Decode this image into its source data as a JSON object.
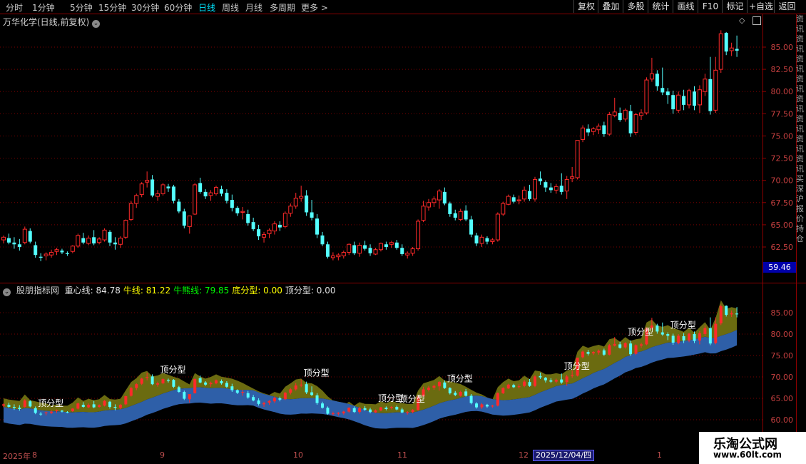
{
  "toolbar": {
    "periods": [
      "分时",
      "1分钟",
      "5分钟",
      "15分钟",
      "30分钟",
      "60分钟",
      "日线",
      "周线",
      "月线",
      "多周期",
      "更多 >"
    ],
    "active_period": "日线",
    "buttons": [
      "复权",
      "叠加",
      "多股",
      "统计",
      "画线",
      "F10",
      "标记",
      "+自选",
      "返回"
    ]
  },
  "main_chart": {
    "title": "万华化学(日线,前复权)",
    "y_ticks": [
      "85.00",
      "82.50",
      "80.00",
      "77.50",
      "75.00",
      "72.50",
      "70.00",
      "67.50",
      "65.00",
      "62.50"
    ],
    "y_tick_values": [
      85,
      82.5,
      80,
      77.5,
      75,
      72.5,
      70,
      67.5,
      65,
      62.5
    ],
    "current_price_badge": "59.46",
    "up_color": "#ff2a2a",
    "down_color": "#54ffff"
  },
  "right_panel_text": "资讯资讯资讯资讯资讯资讯资讯资讯买深沪报价持仓",
  "indicator": {
    "name": "股朋指标网",
    "lines": [
      {
        "label": "重心线:",
        "value": "84.78",
        "color": "#e0e0e0"
      },
      {
        "label": "牛线:",
        "value": "81.22",
        "color": "#ffff00"
      },
      {
        "label": "牛熊线:",
        "value": "79.85",
        "color": "#00ff00"
      },
      {
        "label": "底分型:",
        "value": "0.00",
        "color": "#ffff00"
      },
      {
        "label": "顶分型:",
        "value": "0.00",
        "color": "#e0e0e0"
      }
    ],
    "y_ticks": [
      "85.00",
      "80.00",
      "75.00",
      "70.00",
      "65.00",
      "60.00"
    ],
    "y_tick_values": [
      85,
      80,
      75,
      70,
      65,
      60
    ],
    "pattern_label": "顶分型",
    "band_colors": {
      "upper": "#6b6b10",
      "lower": "#2e5fa8"
    }
  },
  "date_axis": {
    "ticks": [
      "2025年",
      "8",
      "9",
      "10",
      "11",
      "12",
      "1"
    ],
    "highlight": "2025/12/04/四"
  },
  "watermark": {
    "line1": "乐淘公式网",
    "line2": "www.60lt.com"
  },
  "chart_data": {
    "type": "candlestick",
    "title": "万华化学(日线,前复权)",
    "candles": [
      [
        63.3,
        63.8,
        62.9,
        63.6
      ],
      [
        63.5,
        64.0,
        62.8,
        63.0
      ],
      [
        63.0,
        63.6,
        62.3,
        62.8
      ],
      [
        62.8,
        63.4,
        62.1,
        62.5
      ],
      [
        63.0,
        64.8,
        62.8,
        64.5
      ],
      [
        64.3,
        64.6,
        62.9,
        63.1
      ],
      [
        62.7,
        63.1,
        61.3,
        61.6
      ],
      [
        61.4,
        61.8,
        60.9,
        61.3
      ],
      [
        61.5,
        61.9,
        61.0,
        61.7
      ],
      [
        61.6,
        62.2,
        61.3,
        61.9
      ],
      [
        62.0,
        62.4,
        61.6,
        62.2
      ],
      [
        62.1,
        62.3,
        61.7,
        61.9
      ],
      [
        61.8,
        62.0,
        61.5,
        61.7
      ],
      [
        62.0,
        62.7,
        61.8,
        62.6
      ],
      [
        62.6,
        64.0,
        62.4,
        63.8
      ],
      [
        63.5,
        64.1,
        62.8,
        63.0
      ],
      [
        62.9,
        63.8,
        62.7,
        63.5
      ],
      [
        63.6,
        64.4,
        62.7,
        62.9
      ],
      [
        63.0,
        63.6,
        62.8,
        63.4
      ],
      [
        63.3,
        64.6,
        63.1,
        64.4
      ],
      [
        64.2,
        64.4,
        62.6,
        63.0
      ],
      [
        63.0,
        63.6,
        62.2,
        62.8
      ],
      [
        62.8,
        63.7,
        62.4,
        63.5
      ],
      [
        63.6,
        65.6,
        63.4,
        65.5
      ],
      [
        65.6,
        67.7,
        65.4,
        67.4
      ],
      [
        67.4,
        68.5,
        66.9,
        68.3
      ],
      [
        68.4,
        69.8,
        68.1,
        69.6
      ],
      [
        69.8,
        71.0,
        69.2,
        70.0
      ],
      [
        70.1,
        70.6,
        68.1,
        68.3
      ],
      [
        68.2,
        68.9,
        67.7,
        68.5
      ],
      [
        68.5,
        69.7,
        68.3,
        69.5
      ],
      [
        69.3,
        69.6,
        68.7,
        69.1
      ],
      [
        69.3,
        69.5,
        67.4,
        67.7
      ],
      [
        67.6,
        67.9,
        66.3,
        66.5
      ],
      [
        66.5,
        66.8,
        64.6,
        64.9
      ],
      [
        64.8,
        65.0,
        64.0,
        66.0
      ],
      [
        66.2,
        69.7,
        66.1,
        69.5
      ],
      [
        69.7,
        70.3,
        68.5,
        68.7
      ],
      [
        68.7,
        69.0,
        67.9,
        68.2
      ],
      [
        68.3,
        68.9,
        67.7,
        68.6
      ],
      [
        68.5,
        69.4,
        68.3,
        69.2
      ],
      [
        69.0,
        69.4,
        68.2,
        68.5
      ],
      [
        68.6,
        69.0,
        67.4,
        67.7
      ],
      [
        67.8,
        68.4,
        66.5,
        66.9
      ],
      [
        66.9,
        67.1,
        66.0,
        66.3
      ],
      [
        66.4,
        67.0,
        65.6,
        66.5
      ],
      [
        66.2,
        66.7,
        64.9,
        65.2
      ],
      [
        65.3,
        65.8,
        64.3,
        64.5
      ],
      [
        64.5,
        65.0,
        63.3,
        63.7
      ],
      [
        63.6,
        64.2,
        63.0,
        63.9
      ],
      [
        64.0,
        64.6,
        63.5,
        64.4
      ],
      [
        64.3,
        65.4,
        63.9,
        65.1
      ],
      [
        65.0,
        65.4,
        64.3,
        64.7
      ],
      [
        64.8,
        66.5,
        64.6,
        66.3
      ],
      [
        66.3,
        67.4,
        65.9,
        67.1
      ],
      [
        67.1,
        68.6,
        66.8,
        68.0
      ],
      [
        68.0,
        69.4,
        67.6,
        68.2
      ],
      [
        68.3,
        68.9,
        66.0,
        66.4
      ],
      [
        66.4,
        67.8,
        65.5,
        65.8
      ],
      [
        65.7,
        66.2,
        63.5,
        63.9
      ],
      [
        63.8,
        64.2,
        62.6,
        62.8
      ],
      [
        62.8,
        63.1,
        61.2,
        61.4
      ],
      [
        61.3,
        61.9,
        61.0,
        61.5
      ],
      [
        61.4,
        61.8,
        61.0,
        61.6
      ],
      [
        61.5,
        62.1,
        61.2,
        61.9
      ],
      [
        61.9,
        62.9,
        61.6,
        62.8
      ],
      [
        62.7,
        63.1,
        61.6,
        61.8
      ],
      [
        61.8,
        63.0,
        61.4,
        62.7
      ],
      [
        62.7,
        63.2,
        62.1,
        62.3
      ],
      [
        62.4,
        62.8,
        61.5,
        61.8
      ],
      [
        61.7,
        62.4,
        61.6,
        62.2
      ],
      [
        62.2,
        63.0,
        62.0,
        62.9
      ],
      [
        62.8,
        63.1,
        62.2,
        62.5
      ],
      [
        62.8,
        63.2,
        62.4,
        63.0
      ],
      [
        63.0,
        63.3,
        62.2,
        62.4
      ],
      [
        62.4,
        62.8,
        61.5,
        61.7
      ],
      [
        61.6,
        62.0,
        61.2,
        61.8
      ],
      [
        61.8,
        62.5,
        61.5,
        62.3
      ],
      [
        62.3,
        65.6,
        62.1,
        65.4
      ],
      [
        65.5,
        67.7,
        65.3,
        67.1
      ],
      [
        67.0,
        67.9,
        66.6,
        67.5
      ],
      [
        67.5,
        68.2,
        67.0,
        67.9
      ],
      [
        67.8,
        69.0,
        66.8,
        68.8
      ],
      [
        68.7,
        69.2,
        67.2,
        67.4
      ],
      [
        67.4,
        67.6,
        65.9,
        66.2
      ],
      [
        66.3,
        66.7,
        65.5,
        65.8
      ],
      [
        65.6,
        66.8,
        65.4,
        66.5
      ],
      [
        66.6,
        67.2,
        65.4,
        65.6
      ],
      [
        65.6,
        66.0,
        63.6,
        63.9
      ],
      [
        63.8,
        64.1,
        62.6,
        62.9
      ],
      [
        62.9,
        63.9,
        62.5,
        63.6
      ],
      [
        63.5,
        63.7,
        62.8,
        63.1
      ],
      [
        63.1,
        63.5,
        62.8,
        63.3
      ],
      [
        63.3,
        66.4,
        63.1,
        66.2
      ],
      [
        66.2,
        67.6,
        66.0,
        67.4
      ],
      [
        67.3,
        68.4,
        67.2,
        68.2
      ],
      [
        68.1,
        68.4,
        67.4,
        67.6
      ],
      [
        67.7,
        68.3,
        67.3,
        67.8
      ],
      [
        67.9,
        69.3,
        67.6,
        68.9
      ],
      [
        68.8,
        69.5,
        67.7,
        67.9
      ],
      [
        67.9,
        70.4,
        67.6,
        70.1
      ],
      [
        70.2,
        71.0,
        69.5,
        69.9
      ],
      [
        69.8,
        70.0,
        68.7,
        69.2
      ],
      [
        69.2,
        69.7,
        68.6,
        68.9
      ],
      [
        68.9,
        69.6,
        68.5,
        69.3
      ],
      [
        69.4,
        70.8,
        68.4,
        68.7
      ],
      [
        68.8,
        70.5,
        67.9,
        70.1
      ],
      [
        70.2,
        71.5,
        69.8,
        70.4
      ],
      [
        70.3,
        72.3,
        70.1,
        74.5
      ],
      [
        74.6,
        76.2,
        74.3,
        75.9
      ],
      [
        75.8,
        76.3,
        75.0,
        75.4
      ],
      [
        75.5,
        76.0,
        75.1,
        75.8
      ],
      [
        75.7,
        76.4,
        75.2,
        76.1
      ],
      [
        76.2,
        76.6,
        74.9,
        75.2
      ],
      [
        75.2,
        77.7,
        75.0,
        77.4
      ],
      [
        77.3,
        79.3,
        77.1,
        77.7
      ],
      [
        77.6,
        78.2,
        76.6,
        76.8
      ],
      [
        76.9,
        78.1,
        76.6,
        77.9
      ],
      [
        77.8,
        78.5,
        74.9,
        75.3
      ],
      [
        75.4,
        77.6,
        75.1,
        77.4
      ],
      [
        77.3,
        78.0,
        76.8,
        77.6
      ],
      [
        77.6,
        81.6,
        77.4,
        81.3
      ],
      [
        81.4,
        83.8,
        81.1,
        82.0
      ],
      [
        82.0,
        82.4,
        80.1,
        80.6
      ],
      [
        80.4,
        82.7,
        79.6,
        79.9
      ],
      [
        80.0,
        80.4,
        78.6,
        79.6
      ],
      [
        79.6,
        80.1,
        77.5,
        78.0
      ],
      [
        77.9,
        80.0,
        77.6,
        79.6
      ],
      [
        79.5,
        80.2,
        77.9,
        78.5
      ],
      [
        78.5,
        80.3,
        78.1,
        80.1
      ],
      [
        80.0,
        80.6,
        77.9,
        78.4
      ],
      [
        78.5,
        80.7,
        77.6,
        80.2
      ],
      [
        80.0,
        82.0,
        79.5,
        81.4
      ],
      [
        81.4,
        83.9,
        77.4,
        77.8
      ],
      [
        77.9,
        83.9,
        77.6,
        82.4
      ],
      [
        82.5,
        86.9,
        82.1,
        86.5
      ],
      [
        86.6,
        86.7,
        84.1,
        84.5
      ],
      [
        84.6,
        85.5,
        84.0,
        84.9
      ],
      [
        84.8,
        86.3,
        83.9,
        84.6
      ]
    ]
  }
}
